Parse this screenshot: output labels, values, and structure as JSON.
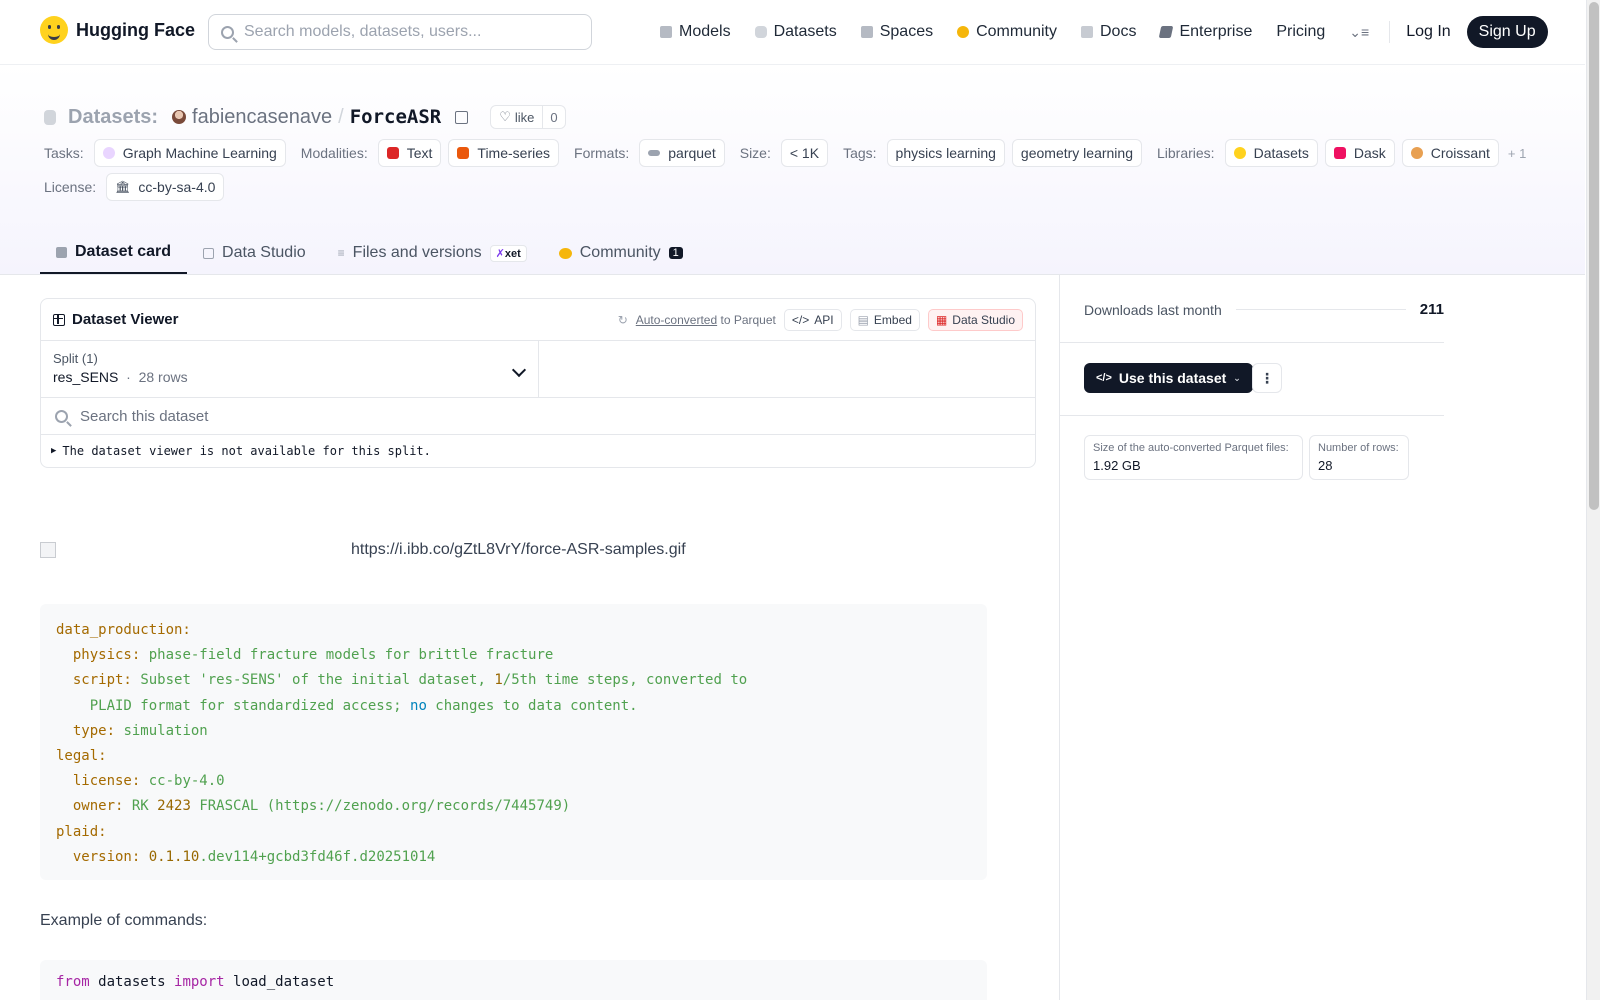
{
  "brand": {
    "name": "Hugging Face"
  },
  "search": {
    "placeholder": "Search models, datasets, users..."
  },
  "nav": {
    "items": [
      {
        "label": "Models",
        "icon": "cube-icon",
        "color": "#9ca3af"
      },
      {
        "label": "Datasets",
        "icon": "database-icon",
        "color": "#d1d5db"
      },
      {
        "label": "Spaces",
        "icon": "grid-icon",
        "color": "#9ca3af"
      },
      {
        "label": "Community",
        "icon": "chat-icon",
        "color": "#f5b60b"
      },
      {
        "label": "Docs",
        "icon": "book-icon",
        "color": "#9ca3af"
      },
      {
        "label": "Enterprise",
        "icon": "briefcase-icon",
        "color": "#6b7280"
      },
      {
        "label": "Pricing",
        "icon": "",
        "color": ""
      }
    ],
    "login": "Log In",
    "signup": "Sign Up"
  },
  "repo": {
    "type_label": "Datasets:",
    "owner": "fabiencasenave",
    "separator": "/",
    "name": "ForceASR",
    "like_label": "like",
    "like_count": "0"
  },
  "tags": {
    "tasks_label": "Tasks:",
    "tasks": [
      "Graph Machine Learning"
    ],
    "modalities_label": "Modalities:",
    "modalities": [
      "Text",
      "Time-series"
    ],
    "formats_label": "Formats:",
    "formats": [
      "parquet"
    ],
    "size_label": "Size:",
    "size": [
      "< 1K"
    ],
    "tags_label": "Tags:",
    "tags": [
      "physics learning",
      "geometry learning"
    ],
    "libraries_label": "Libraries:",
    "libraries": [
      "Datasets",
      "Dask",
      "Croissant"
    ],
    "libraries_more": "+ 1",
    "license_label": "License:",
    "license": "cc-by-sa-4.0"
  },
  "tabs": [
    {
      "label": "Dataset card",
      "active": true
    },
    {
      "label": "Data Studio"
    },
    {
      "label": "Files and versions",
      "badge": "xet"
    },
    {
      "label": "Community",
      "count": "1"
    }
  ],
  "viewer": {
    "title": "Dataset Viewer",
    "auto_converted": "Auto-converted",
    "to_parquet": "to Parquet",
    "api": "API",
    "embed": "Embed",
    "data_studio": "Data Studio",
    "split_label": "Split (1)",
    "split_name": "res_SENS",
    "split_rows": "28 rows",
    "search_placeholder": "Search this dataset",
    "unavailable": "The dataset viewer is not available for this split."
  },
  "card": {
    "image_url": "https://i.ibb.co/gZtL8VrY/force-ASR-samples.gif",
    "example_label": "Example of commands:"
  },
  "sidebar": {
    "downloads_label": "Downloads last month",
    "downloads_value": "211",
    "use_button": "Use this dataset",
    "parquet_size_label": "Size of the auto-converted Parquet files:",
    "parquet_size_value": "1.92 GB",
    "rows_label": "Number of rows:",
    "rows_value": "28"
  },
  "colors": {
    "accent_dark": "#111827",
    "header_gradient_end": "#f5f4fd",
    "code_bg": "#f8f9fa"
  }
}
